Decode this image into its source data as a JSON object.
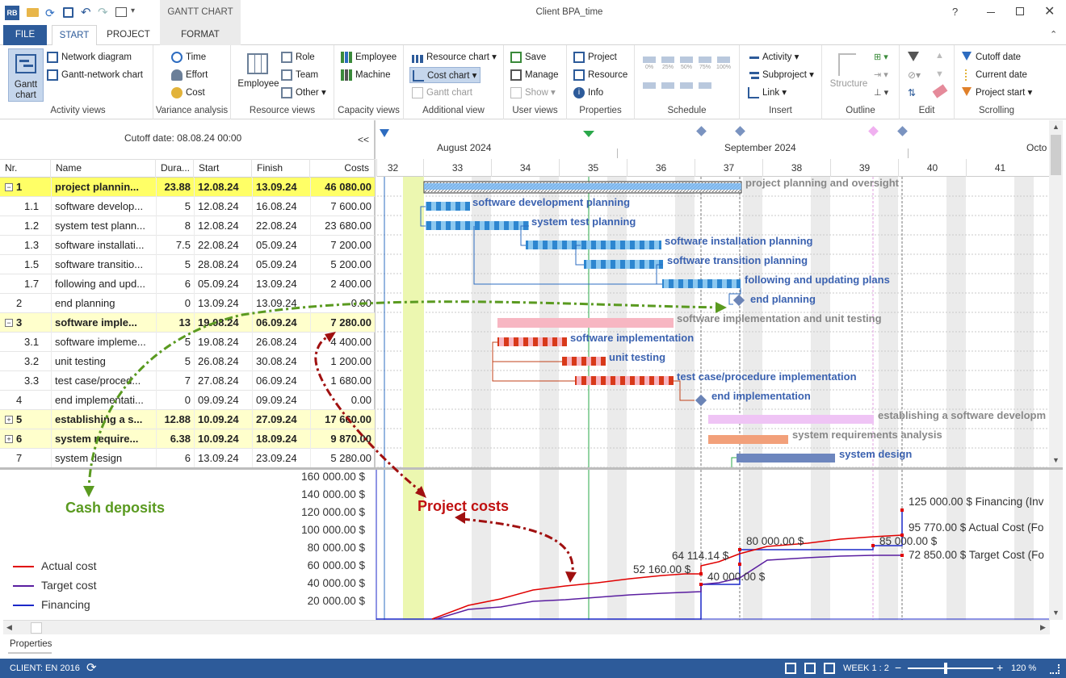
{
  "window": {
    "title": "Client BPA_time",
    "context_tab": "GANTT CHART"
  },
  "ribbon_tabs": {
    "file": "FILE",
    "start": "START",
    "project": "PROJECT",
    "format": "FORMAT"
  },
  "activity_views": {
    "gantt_chart": "Gantt chart",
    "network_diagram": "Network diagram",
    "gantt_network": "Gantt-network chart",
    "label": "Activity views"
  },
  "variance": {
    "time": "Time",
    "effort": "Effort",
    "cost": "Cost",
    "label": "Variance analysis"
  },
  "resource_views": {
    "employee": "Employee",
    "role": "Role",
    "team": "Team",
    "other": "Other",
    "label": "Resource views"
  },
  "capacity_views": {
    "employee": "Employee",
    "machine": "Machine",
    "label": "Capacity views"
  },
  "additional_view": {
    "resource_chart": "Resource chart",
    "cost_chart": "Cost chart",
    "gantt_chart": "Gantt chart",
    "label": "Additional view"
  },
  "user_views": {
    "save": "Save",
    "manage": "Manage",
    "show": "Show",
    "label": "User views"
  },
  "properties_grp": {
    "project": "Project",
    "resource": "Resource",
    "info": "Info",
    "label": "Properties"
  },
  "schedule": {
    "label": "Schedule",
    "pcts": [
      "0%",
      "25%",
      "50%",
      "75%",
      "100%"
    ]
  },
  "insert": {
    "activity": "Activity",
    "subproject": "Subproject",
    "link": "Link",
    "label": "Insert"
  },
  "outline": {
    "structure": "Structure",
    "label": "Outline"
  },
  "edit": {
    "label": "Edit"
  },
  "scrolling": {
    "cutoff_date": "Cutoff date",
    "current_date": "Current date",
    "project_start": "Project start",
    "label": "Scrolling"
  },
  "cutoff_display": "Cutoff date: 08.08.24 00:00",
  "collapse_btn": "<<",
  "columns": {
    "nr": "Nr.",
    "name": "Name",
    "duration": "Dura...",
    "start": "Start",
    "finish": "Finish",
    "costs": "Costs"
  },
  "rows": [
    {
      "nr": "1",
      "name": "project plannin...",
      "dur": "23.88",
      "start": "12.08.24",
      "finish": "13.09.24",
      "cost": "46 080.00",
      "level": 0,
      "summary": true,
      "expand": "−"
    },
    {
      "nr": "1.1",
      "name": "software develop...",
      "dur": "5",
      "start": "12.08.24",
      "finish": "16.08.24",
      "cost": "7 600.00",
      "level": 1
    },
    {
      "nr": "1.2",
      "name": "system test plann...",
      "dur": "8",
      "start": "12.08.24",
      "finish": "22.08.24",
      "cost": "23 680.00",
      "level": 1
    },
    {
      "nr": "1.3",
      "name": "software installati...",
      "dur": "7.5",
      "start": "22.08.24",
      "finish": "05.09.24",
      "cost": "7 200.00",
      "level": 1
    },
    {
      "nr": "1.5",
      "name": "software transitio...",
      "dur": "5",
      "start": "28.08.24",
      "finish": "05.09.24",
      "cost": "5 200.00",
      "level": 1
    },
    {
      "nr": "1.7",
      "name": "following and upd...",
      "dur": "6",
      "start": "05.09.24",
      "finish": "13.09.24",
      "cost": "2 400.00",
      "level": 1
    },
    {
      "nr": "2",
      "name": "end planning",
      "dur": "0",
      "start": "13.09.24",
      "finish": "13.09.24",
      "cost": "0.00",
      "level": 0
    },
    {
      "nr": "3",
      "name": "software imple...",
      "dur": "13",
      "start": "19.08.24",
      "finish": "06.09.24",
      "cost": "7 280.00",
      "level": 0,
      "summary": true,
      "expand": "−"
    },
    {
      "nr": "3.1",
      "name": "software impleme...",
      "dur": "5",
      "start": "19.08.24",
      "finish": "26.08.24",
      "cost": "4 400.00",
      "level": 1
    },
    {
      "nr": "3.2",
      "name": "unit testing",
      "dur": "5",
      "start": "26.08.24",
      "finish": "30.08.24",
      "cost": "1 200.00",
      "level": 1
    },
    {
      "nr": "3.3",
      "name": "test case/proced...",
      "dur": "7",
      "start": "27.08.24",
      "finish": "06.09.24",
      "cost": "1 680.00",
      "level": 1
    },
    {
      "nr": "4",
      "name": "end implementati...",
      "dur": "0",
      "start": "09.09.24",
      "finish": "09.09.24",
      "cost": "0.00",
      "level": 0
    },
    {
      "nr": "5",
      "name": "establishing a s...",
      "dur": "12.88",
      "start": "10.09.24",
      "finish": "27.09.24",
      "cost": "17 660.00",
      "level": 0,
      "summary": true,
      "expand": "+"
    },
    {
      "nr": "6",
      "name": "system require...",
      "dur": "6.38",
      "start": "10.09.24",
      "finish": "18.09.24",
      "cost": "9 870.00",
      "level": 0,
      "summary": true,
      "expand": "+"
    },
    {
      "nr": "7",
      "name": "system design",
      "dur": "6",
      "start": "13.09.24",
      "finish": "23.09.24",
      "cost": "5 280.00",
      "level": 0
    }
  ],
  "timeline": {
    "month1": "August 2024",
    "month2": "September 2024",
    "month3": "Octo",
    "weeks": [
      "32",
      "33",
      "34",
      "35",
      "36",
      "37",
      "38",
      "39",
      "40",
      "41"
    ]
  },
  "gantt_labels": {
    "r0": "project planning and oversight",
    "r1": "software development planning",
    "r2": "system test planning",
    "r3": "software installation planning",
    "r4": "software transition planning",
    "r5": "following and updating plans",
    "r6": "end planning",
    "r7": "software implementation and unit testing",
    "r8": "software implementation",
    "r9": "unit testing",
    "r10": "test case/procedure implementation",
    "r11": "end implementation",
    "r12": "establishing a software developm",
    "r13": "system requirements analysis",
    "r14": "system design"
  },
  "cost_axis": [
    "160 000.00 $",
    "140 000.00 $",
    "120 000.00 $",
    "100 000.00 $",
    "80 000.00 $",
    "60 000.00 $",
    "40 000.00 $",
    "20 000.00 $"
  ],
  "cost_annotations": {
    "a1": "125 000.00 $ Financing (Inv",
    "a2": "95 770.00 $ Actual Cost (Fo",
    "a3": "85 000.00 $",
    "a4": "80 000.00 $",
    "a5": "72 850.00 $ Target Cost (Fo",
    "a6": "64 114.14 $",
    "a7": "52 160.00 $",
    "a8": "40 000.00 $"
  },
  "legend": {
    "actual": "Actual cost",
    "target": "Target cost",
    "financing": "Financing"
  },
  "callouts": {
    "cash": "Cash deposits",
    "costs": "Project costs"
  },
  "chart_data": {
    "type": "line",
    "ylim": [
      0,
      160000
    ],
    "series": [
      {
        "name": "Actual cost",
        "color": "#e00000",
        "end_value": 95770
      },
      {
        "name": "Target cost",
        "color": "#5a1ea0",
        "end_value": 72850
      },
      {
        "name": "Financing",
        "color": "#1c28c8",
        "steps": [
          40000,
          80000,
          85000,
          125000
        ]
      }
    ]
  },
  "bottom": {
    "properties_tab": "Properties"
  },
  "status": {
    "client": "CLIENT: EN 2016",
    "week": "WEEK 1 : 2",
    "zoom": "120 %"
  },
  "colors": {
    "file_tab": "#2d5b9a",
    "status_bar": "#2d5b9a",
    "summary_row": "#ffff66",
    "summary_row_light": "#ffffcc"
  }
}
